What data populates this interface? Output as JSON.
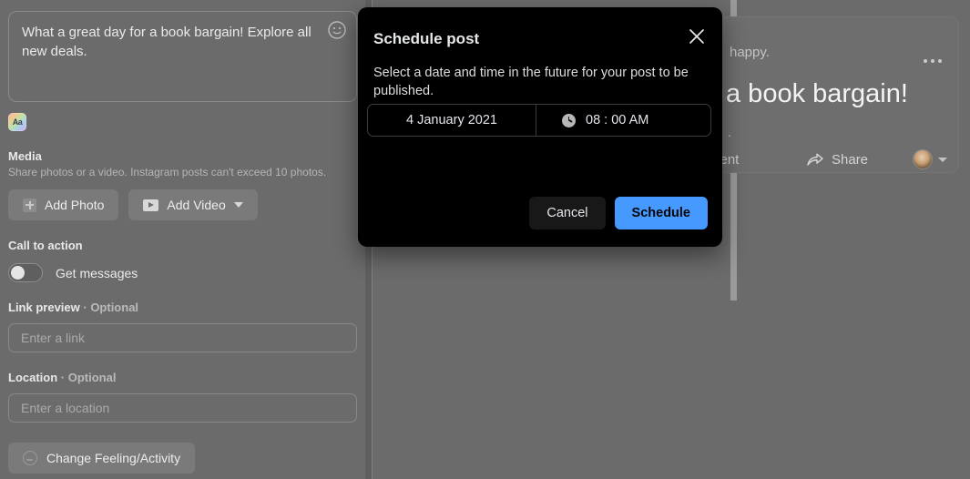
{
  "composer": {
    "post_text": "What a great day for a book bargain! Explore all new deals.",
    "emoji_icon": "smiley-icon",
    "background_picker_label": "Aa",
    "media": {
      "title": "Media",
      "subtitle": "Share photos or a video. Instagram posts can't exceed 10 photos.",
      "add_photo_label": "Add Photo",
      "add_video_label": "Add Video"
    },
    "call_to_action": {
      "title": "Call to action",
      "toggle_label": "Get messages",
      "toggle_state": "off"
    },
    "link_preview": {
      "label": "Link preview",
      "optional": "· Optional",
      "placeholder": "Enter a link",
      "value": ""
    },
    "location": {
      "label": "Location",
      "optional": "· Optional",
      "placeholder": "Enter a location",
      "value": ""
    },
    "feeling_button_label": "Change Feeling/Activity"
  },
  "preview": {
    "line_top": "happy.",
    "headline": "a book bargain!",
    "line_tail": ".",
    "menu_icon": "ellipsis-icon",
    "comment_label": "ment",
    "share_label": "Share",
    "avatar": "user-avatar"
  },
  "modal": {
    "title": "Schedule post",
    "close_icon": "close-icon",
    "description": "Select a date and time in the future for your post to be published.",
    "date_value": "4 January 2021",
    "time_icon": "clock-icon",
    "time_value": "08 : 00 AM",
    "cancel_label": "Cancel",
    "schedule_label": "Schedule"
  },
  "colors": {
    "modal_bg": "#000000",
    "dim_overlay": "#6b6b6b",
    "accent_blue": "#4599ff",
    "button_gray": "#7a7a7a"
  }
}
